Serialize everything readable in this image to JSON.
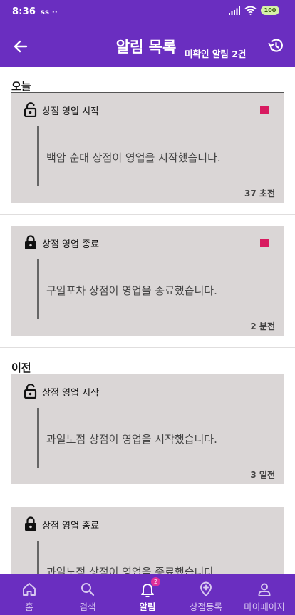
{
  "status_bar": {
    "time": "8:36",
    "extra": "ss ··",
    "battery": "100"
  },
  "header": {
    "title": "알림 목록",
    "unread_summary": "미확인 알림 2건"
  },
  "sections": {
    "today": "오늘",
    "earlier": "이전"
  },
  "notifications": [
    {
      "title": "상점 영업 시작",
      "body": "백암 순대 상점이 영업을 시작했습니다.",
      "time": "37 초전",
      "icon": "lock-open-icon",
      "unread": true
    },
    {
      "title": "상점 영업 종료",
      "body": "구일포차 상점이 영업을 종료했습니다.",
      "time": "2 분전",
      "icon": "lock-closed-icon",
      "unread": true
    },
    {
      "title": "상점 영업 시작",
      "body": "과일노점 상점이 영업을 시작했습니다.",
      "time": "3 일전",
      "icon": "lock-open-icon",
      "unread": false
    },
    {
      "title": "상점 영업 종료",
      "body": "과일노점 상점이 영업을 종료했습니다.",
      "time": "",
      "icon": "lock-closed-icon",
      "unread": false
    }
  ],
  "nav": {
    "items": [
      {
        "label": "홈",
        "icon": "home-icon"
      },
      {
        "label": "검색",
        "icon": "search-icon"
      },
      {
        "label": "알림",
        "icon": "bell-icon",
        "badge": "2",
        "active": true
      },
      {
        "label": "상점등록",
        "icon": "add-store-icon"
      },
      {
        "label": "마이페이지",
        "icon": "person-icon"
      }
    ]
  },
  "colors": {
    "primary": "#6a2ec0",
    "card": "#dad6d6",
    "unread_dot": "#d81b60",
    "badge": "#e0309a"
  }
}
